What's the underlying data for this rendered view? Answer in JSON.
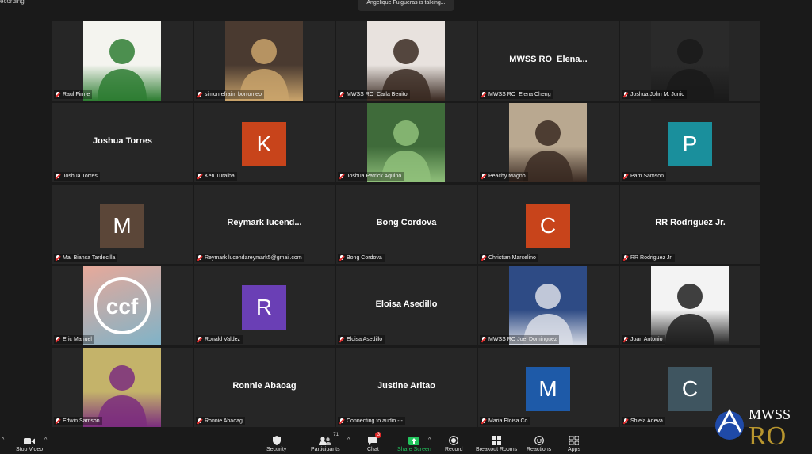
{
  "top": {
    "recording_label": "ecording",
    "talking": "Angelique Fulgueras is talking..."
  },
  "tiles": [
    {
      "name": "Raul Firme",
      "type": "photo",
      "bg": "#f4f4ef",
      "accent": "#2e7d32"
    },
    {
      "name": "simon efraim borromeo",
      "type": "photo",
      "bg": "#4a3a30",
      "accent": "#c9a36b"
    },
    {
      "name": "MWSS RO_Carla Benito",
      "type": "photo",
      "bg": "#e8e2de",
      "accent": "#3a2a22"
    },
    {
      "name": "MWSS RO_Elena Cheng",
      "type": "text",
      "display": "MWSS  RO_Elena..."
    },
    {
      "name": "Joshua John M. Junio",
      "type": "photo",
      "bg": "#2a2a2a",
      "accent": "#1a1a1a"
    },
    {
      "name": "Joshua Torres",
      "type": "text",
      "display": "Joshua Torres"
    },
    {
      "name": "Ken Turalba",
      "type": "letter",
      "letter": "K",
      "color": "#c8441b"
    },
    {
      "name": "Joshua Patrick Aquino",
      "type": "photo",
      "bg": "#3f6b3a",
      "accent": "#8fbf7a"
    },
    {
      "name": "Peachy Magno",
      "type": "photo",
      "bg": "#b9a890",
      "accent": "#3a2a22"
    },
    {
      "name": "Pam Samson",
      "type": "letter",
      "letter": "P",
      "color": "#1a8f9c"
    },
    {
      "name": "Ma. Bianca Tardecilla",
      "type": "letter",
      "letter": "M",
      "color": "#5b4638"
    },
    {
      "name": "Reymark lucendareymark5@gmail.com",
      "type": "text",
      "display": "Reymark  lucend..."
    },
    {
      "name": "Bong Cordova",
      "type": "text",
      "display": "Bong Cordova"
    },
    {
      "name": "Christian Marcelino",
      "type": "letter",
      "letter": "C",
      "color": "#c8441b"
    },
    {
      "name": "RR Rodriguez Jr.",
      "type": "text",
      "display": "RR Rodriguez Jr."
    },
    {
      "name": "Eric Manuel",
      "type": "ccf",
      "bg": "#7fb3c8",
      "accent": "#e7a99a"
    },
    {
      "name": "Ronald Valdez",
      "type": "letter",
      "letter": "R",
      "color": "#6a3fb5"
    },
    {
      "name": "Eloisa Asedillo",
      "type": "text",
      "display": "Eloisa Asedillo"
    },
    {
      "name": "MWSS RO Joel Dominguez",
      "type": "photo",
      "bg": "#2e4b85",
      "accent": "#d9dde6"
    },
    {
      "name": "Joan Antonio",
      "type": "photo",
      "bg": "#f3f3f3",
      "accent": "#1f1f1f"
    },
    {
      "name": "Edwin Samson",
      "type": "photo",
      "bg": "#c4b36a",
      "accent": "#7b2d7e"
    },
    {
      "name": "Ronnie Abaoag",
      "type": "text",
      "display": "Ronnie Abaoag"
    },
    {
      "name": "Connecting to audio -.-",
      "type": "text",
      "display": "Justine Aritao"
    },
    {
      "name": "Maria Eloisa Co",
      "type": "letter",
      "letter": "M",
      "color": "#1e5aa8"
    },
    {
      "name": "Shiela Adeva",
      "type": "letter",
      "letter": "C",
      "color": "#3f5560"
    }
  ],
  "toolbar": {
    "stop_video": "Stop Video",
    "security": "Security",
    "participants": "Participants",
    "participants_count": "71",
    "chat": "Chat",
    "chat_badge": "3",
    "share_screen": "Share Screen",
    "record": "Record",
    "breakout_rooms": "Breakout Rooms",
    "reactions": "Reactions",
    "apps": "Apps"
  },
  "logo": {
    "line1": "MWSS",
    "line2": "RO"
  },
  "colors": {
    "share_green": "#23c55e",
    "logo_blue": "#1f4aa8",
    "logo_gold": "#b8962e"
  }
}
